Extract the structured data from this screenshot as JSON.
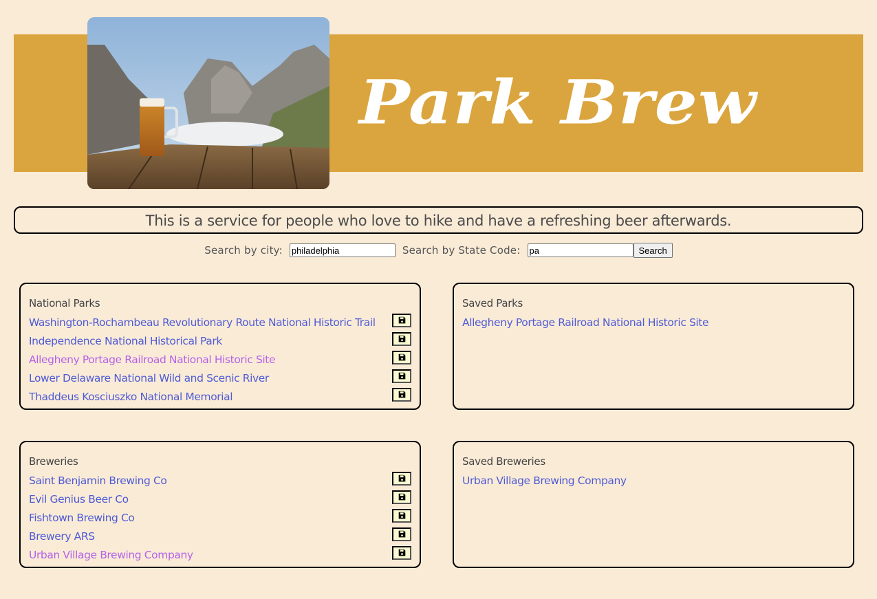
{
  "header": {
    "title": "Park Brew",
    "hero_image_alt": "Beer mug on a wooden table overlooking mountains",
    "banner_color": "#daa53e"
  },
  "tagline": "This is a service for people who love to hike and have a refreshing beer afterwards.",
  "search": {
    "city_label": "Search by city:",
    "city_value": "philadelphia",
    "state_label": "Search by State Code:",
    "state_value": "pa",
    "button_label": "Search"
  },
  "parks": {
    "title": "National Parks",
    "items": [
      {
        "name": "Washington-Rochambeau Revolutionary Route National Historic Trail",
        "visited": false,
        "save_icon": "floppy-disk-icon"
      },
      {
        "name": "Independence National Historical Park",
        "visited": false,
        "save_icon": "floppy-disk-icon"
      },
      {
        "name": "Allegheny Portage Railroad National Historic Site",
        "visited": true,
        "save_icon": "floppy-disk-icon"
      },
      {
        "name": "Lower Delaware National Wild and Scenic River",
        "visited": false,
        "save_icon": "floppy-disk-icon"
      },
      {
        "name": "Thaddeus Kosciuszko National Memorial",
        "visited": false,
        "save_icon": "floppy-disk-icon"
      }
    ]
  },
  "saved_parks": {
    "title": "Saved Parks",
    "items": [
      {
        "name": "Allegheny Portage Railroad National Historic Site"
      }
    ]
  },
  "breweries": {
    "title": "Breweries",
    "items": [
      {
        "name": "Saint Benjamin Brewing Co",
        "visited": false,
        "save_icon": "floppy-disk-icon"
      },
      {
        "name": "Evil Genius Beer Co",
        "visited": false,
        "save_icon": "floppy-disk-icon"
      },
      {
        "name": "Fishtown Brewing Co",
        "visited": false,
        "save_icon": "floppy-disk-icon"
      },
      {
        "name": "Brewery ARS",
        "visited": false,
        "save_icon": "floppy-disk-icon"
      },
      {
        "name": "Urban Village Brewing Company",
        "visited": true,
        "save_icon": "floppy-disk-icon"
      }
    ]
  },
  "saved_breweries": {
    "title": "Saved Breweries",
    "items": [
      {
        "name": "Urban Village Brewing Company"
      }
    ]
  },
  "colors": {
    "background": "#faebd7",
    "link": "#4f5bd5",
    "link_visited": "#b462e6",
    "save_button_bg": "#fafad2"
  }
}
